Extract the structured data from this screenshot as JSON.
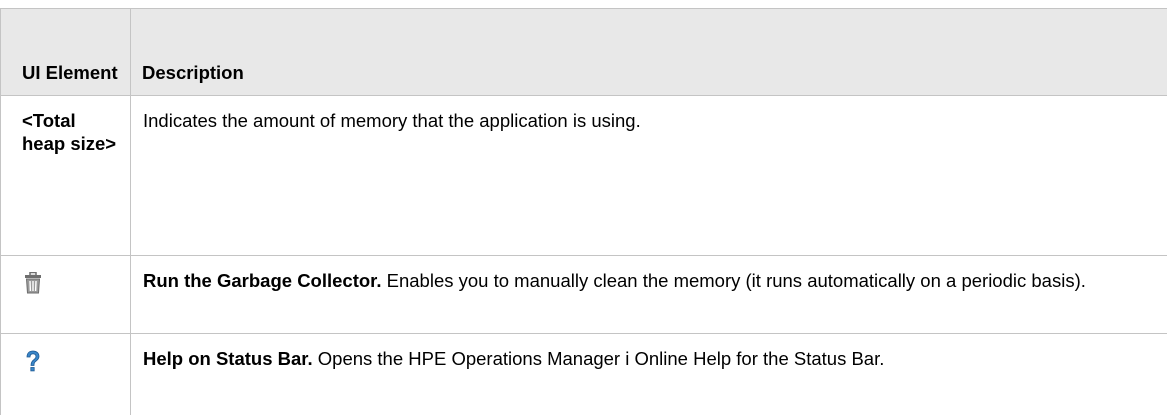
{
  "table": {
    "headers": {
      "ui_element": "UI Element",
      "description": "Description"
    },
    "rows": [
      {
        "element_label": "<Total heap size>",
        "description_lead": "",
        "description_text": "Indicates the amount of memory that the application is using."
      },
      {
        "element_icon": "trash-can-icon",
        "description_lead": "Run the Garbage Collector.",
        "description_text": " Enables you to manually clean the memory (it runs automatically on a periodic basis)."
      },
      {
        "element_icon": "question-mark-icon",
        "description_lead": "Help on Status Bar.",
        "description_text": " Opens the HPE Operations Manager i Online Help for the Status Bar."
      }
    ]
  },
  "colors": {
    "header_background": "#e8e8e8",
    "border": "#c4c4c4",
    "help_icon": "#3a86c8",
    "trash_icon": "#7a7a7a"
  }
}
